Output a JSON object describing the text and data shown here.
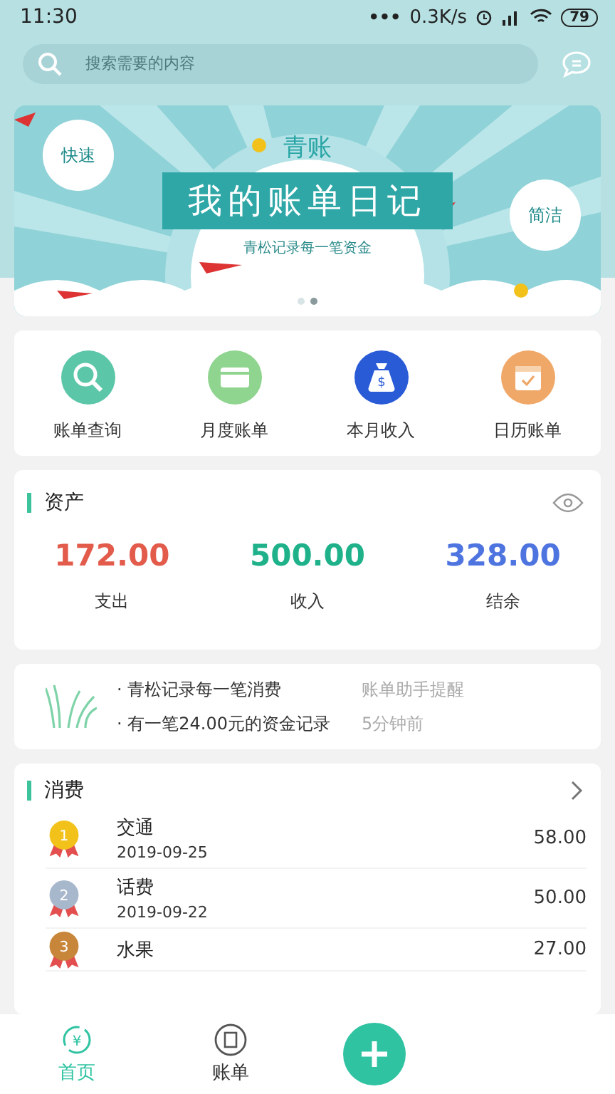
{
  "status_bar": {
    "time": "11:30",
    "dots": "•••",
    "speed": "0.3K/s",
    "battery": "79"
  },
  "search": {
    "placeholder": "搜索需要的内容"
  },
  "banner": {
    "brand": "青账",
    "title": "我的账单日记",
    "subtitle": "青松记录每一笔资金",
    "bubble_left": "快速",
    "bubble_right": "简洁",
    "dots": [
      {
        "selected": false
      },
      {
        "selected": true
      }
    ]
  },
  "shortcuts": [
    {
      "label": "账单查询",
      "kind": "search",
      "color": "#5cc6a8"
    },
    {
      "label": "月度账单",
      "kind": "card",
      "color": "#8fd48f"
    },
    {
      "label": "本月收入",
      "kind": "money",
      "color": "#2a5bd7",
      "icon_text": "$"
    },
    {
      "label": "日历账单",
      "kind": "calendar",
      "color": "#f0a868"
    }
  ],
  "assets": {
    "title": "资产",
    "stats": [
      {
        "value": "172.00",
        "label": "支出",
        "color": "#e25b4b"
      },
      {
        "value": "500.00",
        "label": "收入",
        "color": "#1fb28a"
      },
      {
        "value": "328.00",
        "label": "结余",
        "color": "#4e74e0"
      }
    ]
  },
  "notices": [
    {
      "text": "· 青松记录每一笔消费",
      "meta": "账单助手提醒"
    },
    {
      "text": "· 有一笔24.00元的资金记录",
      "meta": "5分钟前"
    }
  ],
  "expenses": {
    "title": "消费",
    "rows": [
      {
        "rank": "1",
        "color": "#f2c21b",
        "name": "交通",
        "date": "2019-09-25",
        "amount": "58.00"
      },
      {
        "rank": "2",
        "color": "#a8b8cc",
        "name": "话费",
        "date": "2019-09-22",
        "amount": "50.00"
      },
      {
        "rank": "3",
        "color": "#c8863a",
        "name": "水果",
        "amount": "27.00"
      }
    ]
  },
  "nav": [
    {
      "label": "首页",
      "kind": "home",
      "icon_text": "¥",
      "selected": true
    },
    {
      "label": "账单",
      "kind": "bill",
      "selected": false
    },
    {
      "kind": "add",
      "selected": false
    }
  ]
}
